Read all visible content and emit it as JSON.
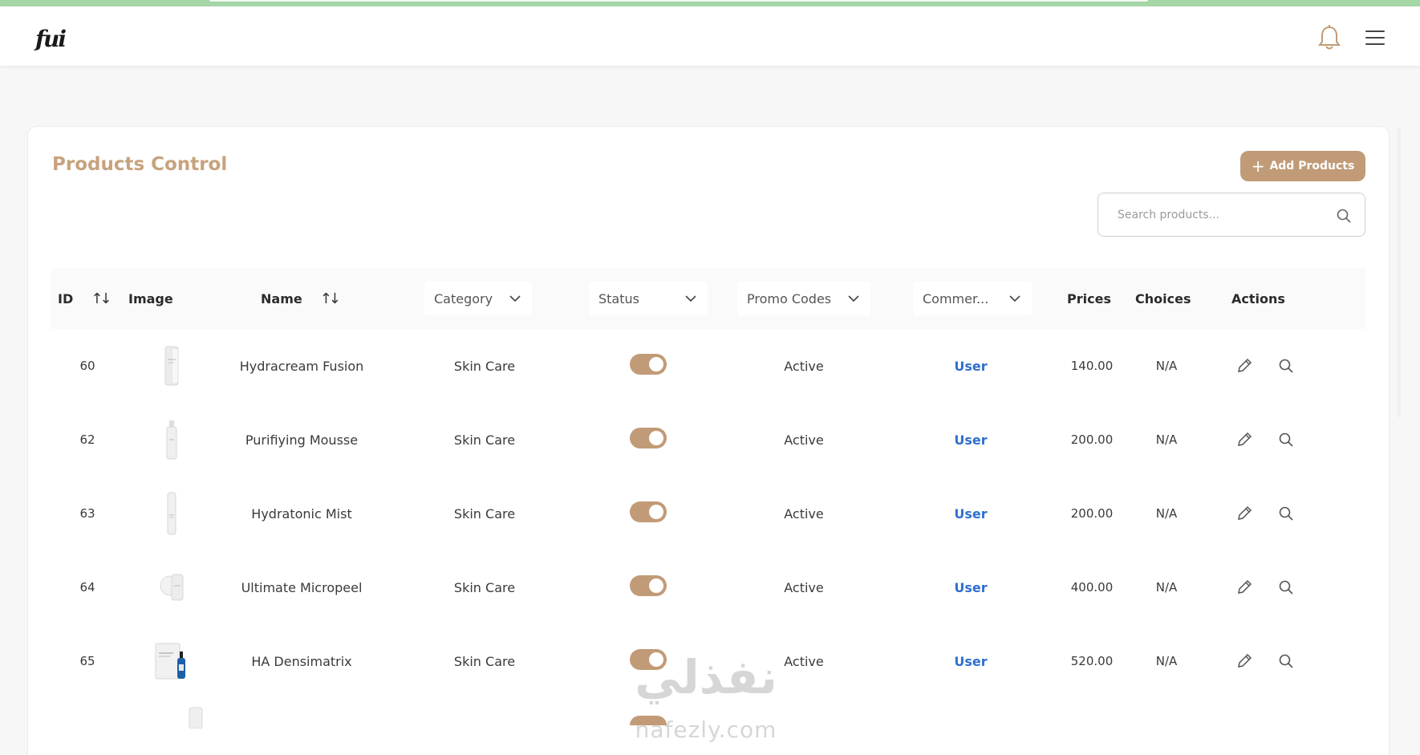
{
  "header": {
    "logo_text": "fui",
    "bell_icon": "bell-icon",
    "menu_icon": "hamburger-menu-icon"
  },
  "card": {
    "title": "Products Control",
    "add_button_label": "Add Products",
    "search_placeholder": "Search products..."
  },
  "table": {
    "headers": {
      "id": "ID",
      "image": "Image",
      "name": "Name",
      "category": "Category",
      "status": "Status",
      "promo_codes": "Promo Codes",
      "commercial": "Commer...",
      "prices": "Prices",
      "choices": "Choices",
      "actions": "Actions"
    },
    "rows": [
      {
        "id": "60",
        "name": "Hydracream Fusion",
        "category": "Skin Care",
        "status_on": true,
        "promo": "Active",
        "commercial": "User",
        "price": "140.00",
        "choices": "N/A"
      },
      {
        "id": "62",
        "name": "Purifiying Mousse",
        "category": "Skin Care",
        "status_on": true,
        "promo": "Active",
        "commercial": "User",
        "price": "200.00",
        "choices": "N/A"
      },
      {
        "id": "63",
        "name": "Hydratonic Mist",
        "category": "Skin Care",
        "status_on": true,
        "promo": "Active",
        "commercial": "User",
        "price": "200.00",
        "choices": "N/A"
      },
      {
        "id": "64",
        "name": "Ultimate Micropeel",
        "category": "Skin Care",
        "status_on": true,
        "promo": "Active",
        "commercial": "User",
        "price": "400.00",
        "choices": "N/A"
      },
      {
        "id": "65",
        "name": "HA Densimatrix",
        "category": "Skin Care",
        "status_on": true,
        "promo": "Active",
        "commercial": "User",
        "price": "520.00",
        "choices": "N/A"
      }
    ]
  },
  "watermark": {
    "arabic": "نفذلي",
    "latin": "nafezly.com"
  },
  "colors": {
    "accent": "#c19b77",
    "title": "#c8a27d",
    "link": "#2f6fce"
  }
}
